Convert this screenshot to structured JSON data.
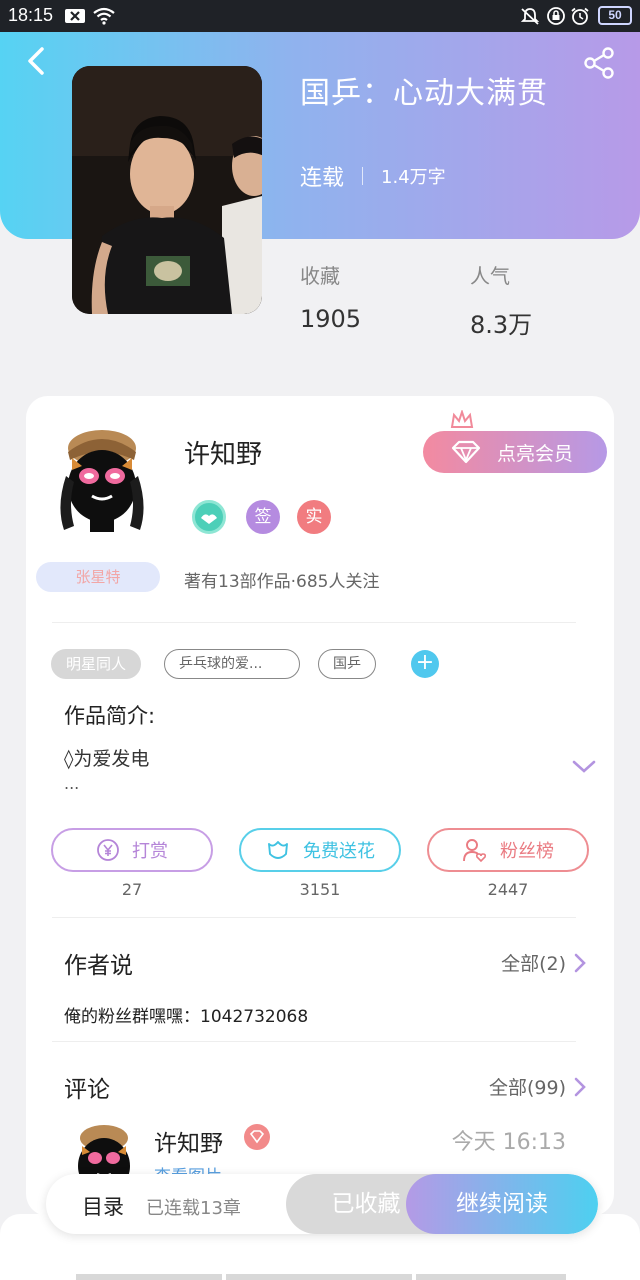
{
  "status_bar": {
    "time": "18:15",
    "battery": "50"
  },
  "book": {
    "title": "国乒：心动大满贯",
    "status": "连载",
    "words": "1.4万字",
    "stats": [
      {
        "label": "收藏",
        "value": "1905"
      },
      {
        "label": "人气",
        "value": "8.3万"
      }
    ]
  },
  "author": {
    "name": "许知野",
    "vip_label": "点亮会员",
    "badges": [
      "签",
      "实"
    ],
    "fan_label": "张星特",
    "stats_text": "著有13部作品·685人关注"
  },
  "tags": [
    "明星同人",
    "乒乓球的爱...",
    "国乒"
  ],
  "intro": {
    "heading": "作品简介:",
    "line": "◊为爱发电",
    "more": "..."
  },
  "actions": [
    {
      "label": "打赏",
      "count": "27"
    },
    {
      "label": "免费送花",
      "count": "3151"
    },
    {
      "label": "粉丝榜",
      "count": "2447"
    }
  ],
  "author_says": {
    "title": "作者说",
    "all": "全部(2)",
    "text": "俺的粉丝群嘿嘿：1042732068"
  },
  "comments": {
    "title": "评论",
    "all": "全部(99)",
    "first": {
      "name": "许知野",
      "time": "今天 16:13",
      "link": "查看图片"
    }
  },
  "bottom_bar": {
    "toc": "目录",
    "toc_sub": "已连载13章",
    "saved": "已收藏",
    "read": "继续阅读"
  },
  "colors": {
    "header_gradient_start": "#56d3f3",
    "header_gradient_end": "#b79ae8",
    "vip_gradient_start": "#f38aa0",
    "vip_gradient_end": "#b699e6",
    "reward": "#b585d8",
    "flower": "#3fc2e2",
    "fans": "#ea7b82"
  }
}
